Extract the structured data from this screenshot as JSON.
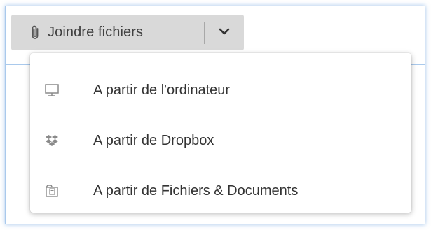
{
  "attach_button": {
    "label": "Joindre fichiers",
    "icon": "paperclip-icon",
    "dropdown_icon": "chevron-down-icon"
  },
  "menu": {
    "items": [
      {
        "label": "A partir de l'ordinateur",
        "icon": "monitor-icon"
      },
      {
        "label": "A partir de Dropbox",
        "icon": "dropbox-icon"
      },
      {
        "label": "A partir de Fichiers & Documents",
        "icon": "files-documents-icon"
      }
    ]
  },
  "colors": {
    "button_bg": "#d9d9d9",
    "frame_border": "#a9c9ec",
    "icon_gray": "#8a8a8a",
    "text": "#333333"
  }
}
